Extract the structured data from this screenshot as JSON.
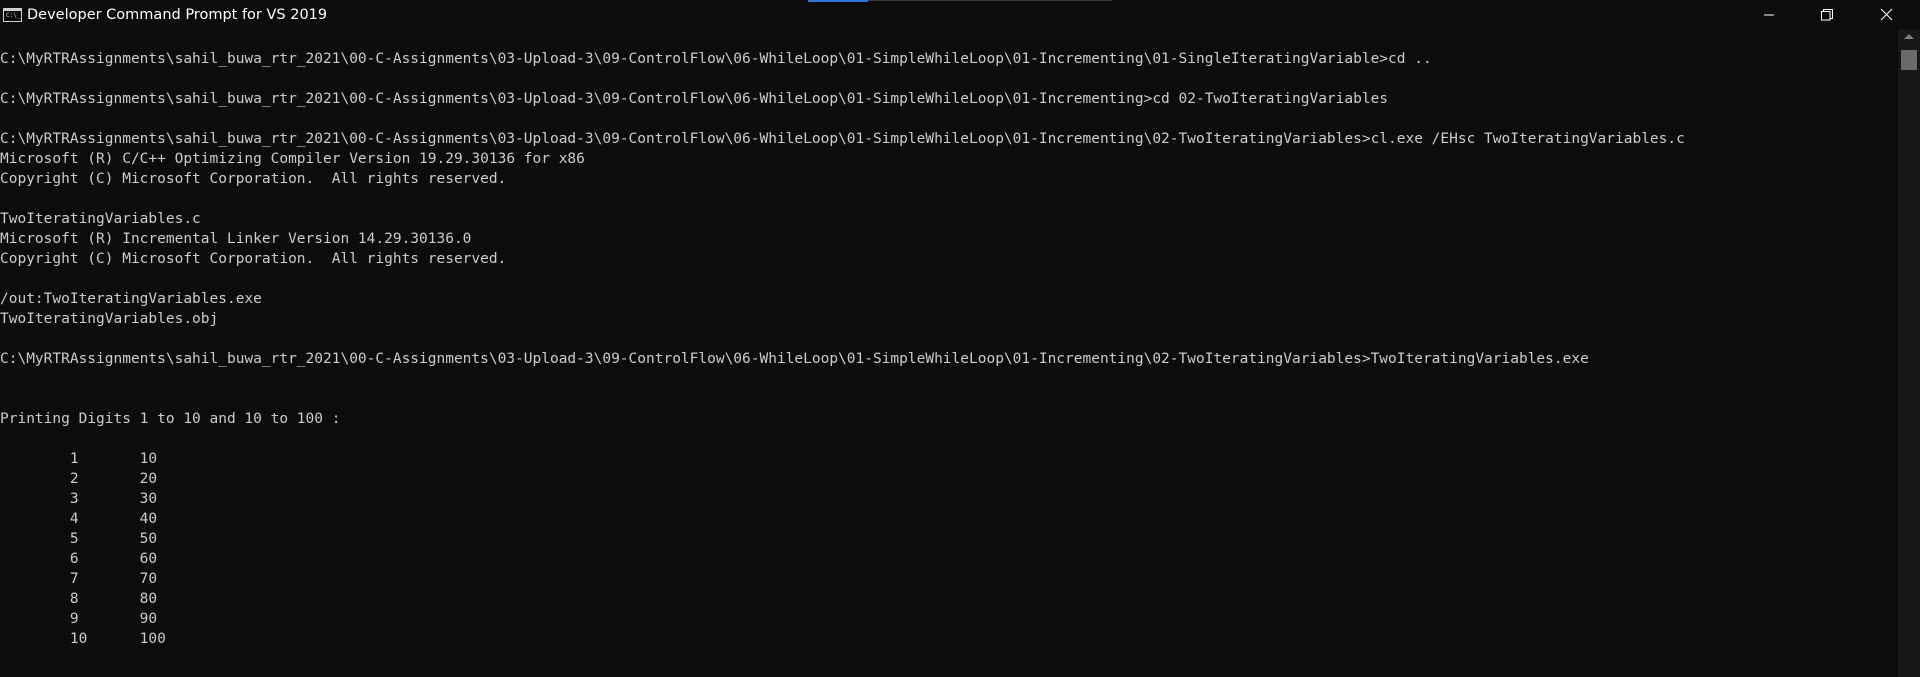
{
  "window": {
    "title": "Developer Command Prompt for VS 2019",
    "icon_name": "console-app-icon",
    "icon_glyph": "C:\\_"
  },
  "caption_buttons": {
    "minimize_icon": "minimize-icon",
    "maximize_icon": "restore-icon",
    "close_icon": "close-icon"
  },
  "console": {
    "lines": [
      "C:\\MyRTRAssignments\\sahil_buwa_rtr_2021\\00-C-Assignments\\03-Upload-3\\09-ControlFlow\\06-WhileLoop\\01-SimpleWhileLoop\\01-Incrementing\\01-SingleIteratingVariable>cd ..",
      "",
      "C:\\MyRTRAssignments\\sahil_buwa_rtr_2021\\00-C-Assignments\\03-Upload-3\\09-ControlFlow\\06-WhileLoop\\01-SimpleWhileLoop\\01-Incrementing>cd 02-TwoIteratingVariables",
      "",
      "C:\\MyRTRAssignments\\sahil_buwa_rtr_2021\\00-C-Assignments\\03-Upload-3\\09-ControlFlow\\06-WhileLoop\\01-SimpleWhileLoop\\01-Incrementing\\02-TwoIteratingVariables>cl.exe /EHsc TwoIteratingVariables.c",
      "Microsoft (R) C/C++ Optimizing Compiler Version 19.29.30136 for x86",
      "Copyright (C) Microsoft Corporation.  All rights reserved.",
      "",
      "TwoIteratingVariables.c",
      "Microsoft (R) Incremental Linker Version 14.29.30136.0",
      "Copyright (C) Microsoft Corporation.  All rights reserved.",
      "",
      "/out:TwoIteratingVariables.exe",
      "TwoIteratingVariables.obj",
      "",
      "C:\\MyRTRAssignments\\sahil_buwa_rtr_2021\\00-C-Assignments\\03-Upload-3\\09-ControlFlow\\06-WhileLoop\\01-SimpleWhileLoop\\01-Incrementing\\02-TwoIteratingVariables>TwoIteratingVariables.exe",
      "",
      "",
      "Printing Digits 1 to 10 and 10 to 100 :",
      "",
      "        1       10",
      "        2       20",
      "        3       30",
      "        4       40",
      "        5       50",
      "        6       60",
      "        7       70",
      "        8       80",
      "        9       90",
      "        10      100"
    ]
  },
  "colors": {
    "background": "#0c0c0c",
    "text": "#cccccc",
    "title_text": "#ffffff"
  }
}
